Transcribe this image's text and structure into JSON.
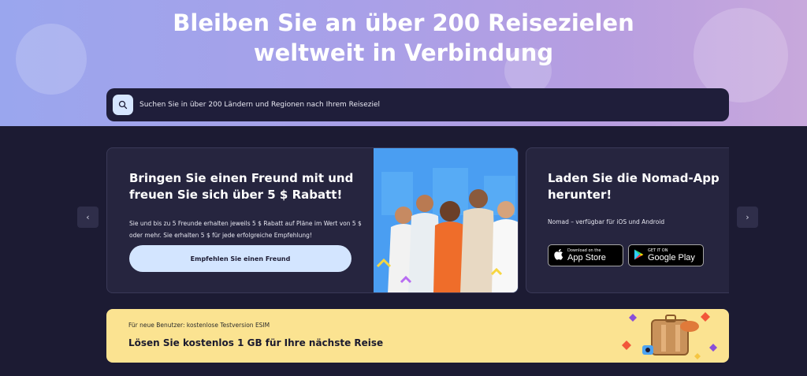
{
  "hero": {
    "title": "Bleiben Sie an über 200 Reisezielen weltweit in Verbindung",
    "search_placeholder": "Suchen Sie in über 200 Ländern und Regionen nach Ihrem Reiseziel"
  },
  "carousel": {
    "prev_icon": "chevron-left-icon",
    "next_icon": "chevron-right-icon",
    "prev_glyph": "‹",
    "next_glyph": "›"
  },
  "referral": {
    "title": "Bringen Sie einen Freund mit und freuen Sie sich über 5 $ Rabatt!",
    "text": "Sie und bis zu 5 Freunde erhalten jeweils 5 $ Rabatt auf Pläne im Wert von 5 $ oder mehr. Sie erhalten 5 $ für jede erfolgreiche Empfehlung!",
    "button": "Empfehlen Sie einen Freund"
  },
  "app": {
    "title": "Laden Sie die Nomad-App herunter!",
    "subtitle": "Nomad – verfügbar für iOS und Android",
    "appstore_small": "Download on the",
    "appstore_big": "App Store",
    "play_small": "GET IT ON",
    "play_big": "Google Play"
  },
  "promo": {
    "small": "Für neue Benutzer: kostenlose Testversion ESIM",
    "big": "Lösen Sie kostenlos 1 GB für Ihre nächste Reise"
  },
  "colors": {
    "background": "#1c1b33",
    "card": "#26253f",
    "accent_light_blue": "#d3e5ff",
    "promo_yellow": "#fbe391"
  }
}
